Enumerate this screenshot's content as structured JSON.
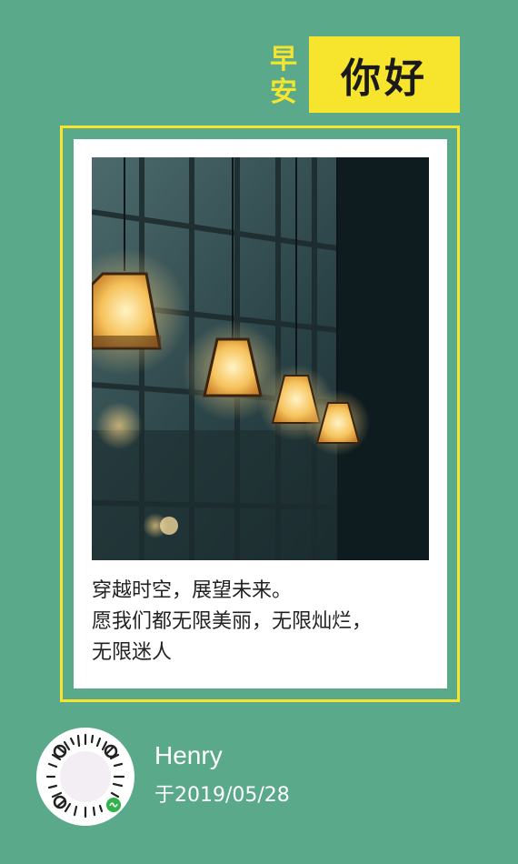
{
  "greeting": {
    "small_top": "早",
    "small_bottom": "安",
    "main": "你好"
  },
  "photo": {
    "description_icon": "pendant-lamps-image"
  },
  "caption": {
    "line1": "穿越时空，展望未来。",
    "line2": "愿我们都无限美丽，无限灿烂，",
    "line3": "无限迷人"
  },
  "footer": {
    "qr_icon": "mini-program-code-icon",
    "author": "Henry",
    "date": "于2019/05/28"
  },
  "colors": {
    "background": "#5aa98a",
    "accent_yellow": "#f7e52d",
    "card": "#ffffff"
  }
}
